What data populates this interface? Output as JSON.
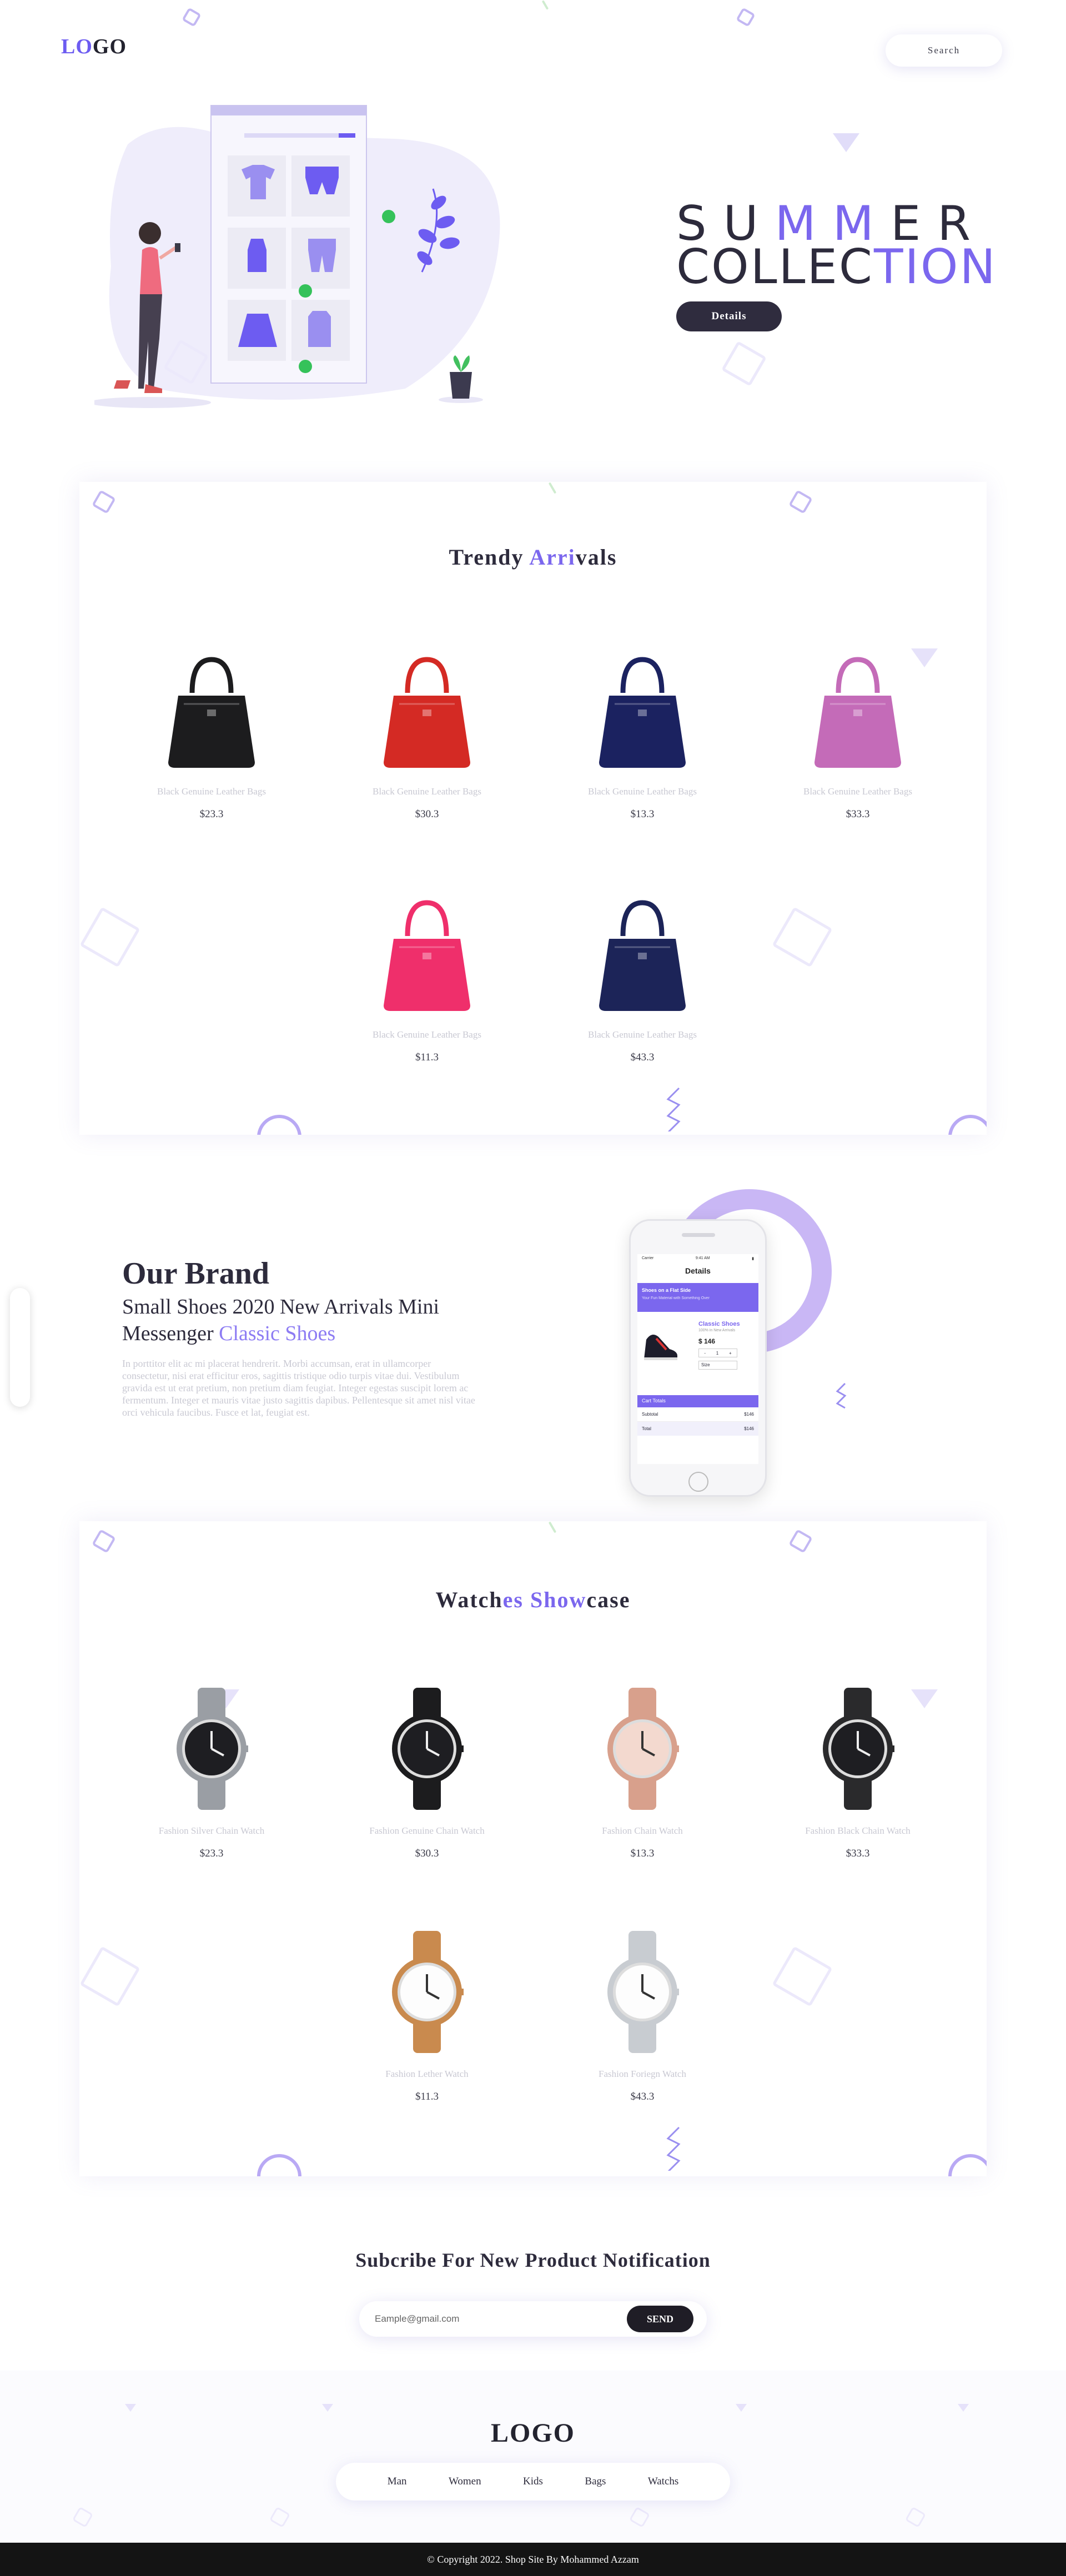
{
  "header": {
    "logo_lo": "LO",
    "logo_go": "GO",
    "search_label": "Search"
  },
  "hero": {
    "summer_a": "S",
    "summer_b": "U",
    "summer_hl": "MM",
    "summer_c": "ER",
    "collection_a": "COLLEC",
    "collection_hl": "TION",
    "details_label": "Details"
  },
  "arrivals": {
    "title_a": "Trendy ",
    "title_hl": "Arri",
    "title_b": "vals",
    "items": [
      {
        "name": "Black Genuine Leather Bags",
        "price": "$23.3",
        "color": "#1c1c1e"
      },
      {
        "name": "Black Genuine Leather Bags",
        "price": "$30.3",
        "color": "#d42a24"
      },
      {
        "name": "Black Genuine Leather Bags",
        "price": "$13.3",
        "color": "#1b2260"
      },
      {
        "name": "Black Genuine Leather Bags",
        "price": "$33.3",
        "color": "#c46bb8"
      },
      {
        "name": "Black Genuine Leather Bags",
        "price": "$11.3",
        "color": "#ef2f6b"
      },
      {
        "name": "Black Genuine Leather Bags",
        "price": "$43.3",
        "color": "#1c2458"
      }
    ]
  },
  "brand": {
    "title": "Our Brand",
    "subtitle": "Small Shoes 2020 New Arrivals Mini Messenger ",
    "subtitle_hl": "Classic Shoes",
    "text": "In porttitor elit ac mi placerat hendrerit. Morbi accumsan, erat in ullamcorper consectetur, nisi erat efficitur eros, sagittis tristique odio turpis vitae dui. Vestibulum gravida est ut erat pretium, non pretium diam feugiat. Integer egestas suscipit lorem ac fermentum. Integer et mauris vitae justo sagittis dapibus. Pellentesque sit amet nisl vitae orci vehicula faucibus. Fusce et lat, feugiat est."
  },
  "phone": {
    "status_left": "Carrier",
    "status_time": "9:41 AM",
    "header": "Details",
    "banner_title": "Shoes on a Flat Side",
    "banner_sub": "Your Fun Material with Something Over",
    "product_name": "Classic Shoes",
    "product_sub": "100% in New Arrivals",
    "product_price": "$ 146",
    "qty": "1",
    "size_label": "Size",
    "cart_label": "Cart Totals",
    "subtotal_label": "Subtotal",
    "subtotal_value": "$146",
    "total_label": "Total",
    "total_value": "$146"
  },
  "watches": {
    "title_a": "Watch",
    "title_hl": "es Show",
    "title_b": "case",
    "items": [
      {
        "name": "Fashion Silver Chain Watch",
        "price": "$23.3",
        "color": "#9a9ea4"
      },
      {
        "name": "Fashion Genuine Chain Watch",
        "price": "$30.3",
        "color": "#1c1c1e"
      },
      {
        "name": "Fashion Chain Watch",
        "price": "$13.3",
        "color": "#d8a08c"
      },
      {
        "name": "Fashion Black Chain Watch",
        "price": "$33.3",
        "color": "#2a2a2c"
      },
      {
        "name": "Fashion Lether Watch",
        "price": "$11.3",
        "color": "#c98a4e"
      },
      {
        "name": "Fashion Foriegn Watch",
        "price": "$43.3",
        "color": "#c8ccd1"
      }
    ]
  },
  "subscribe": {
    "title": "Subcribe For New Product Notification",
    "placeholder": "Eample@gmail.com",
    "send_label": "SEND"
  },
  "footer": {
    "logo": "LOGO",
    "nav": [
      "Man",
      "Women",
      "Kids",
      "Bags",
      "Watchs"
    ],
    "copyright": "© Copyright 2022. Shop Site By Mohammed Azzam"
  },
  "colors": {
    "accent": "#7b67ee",
    "dark": "#2d2b3c",
    "muted": "#c8c8d2",
    "footer_bar": "#141414"
  }
}
